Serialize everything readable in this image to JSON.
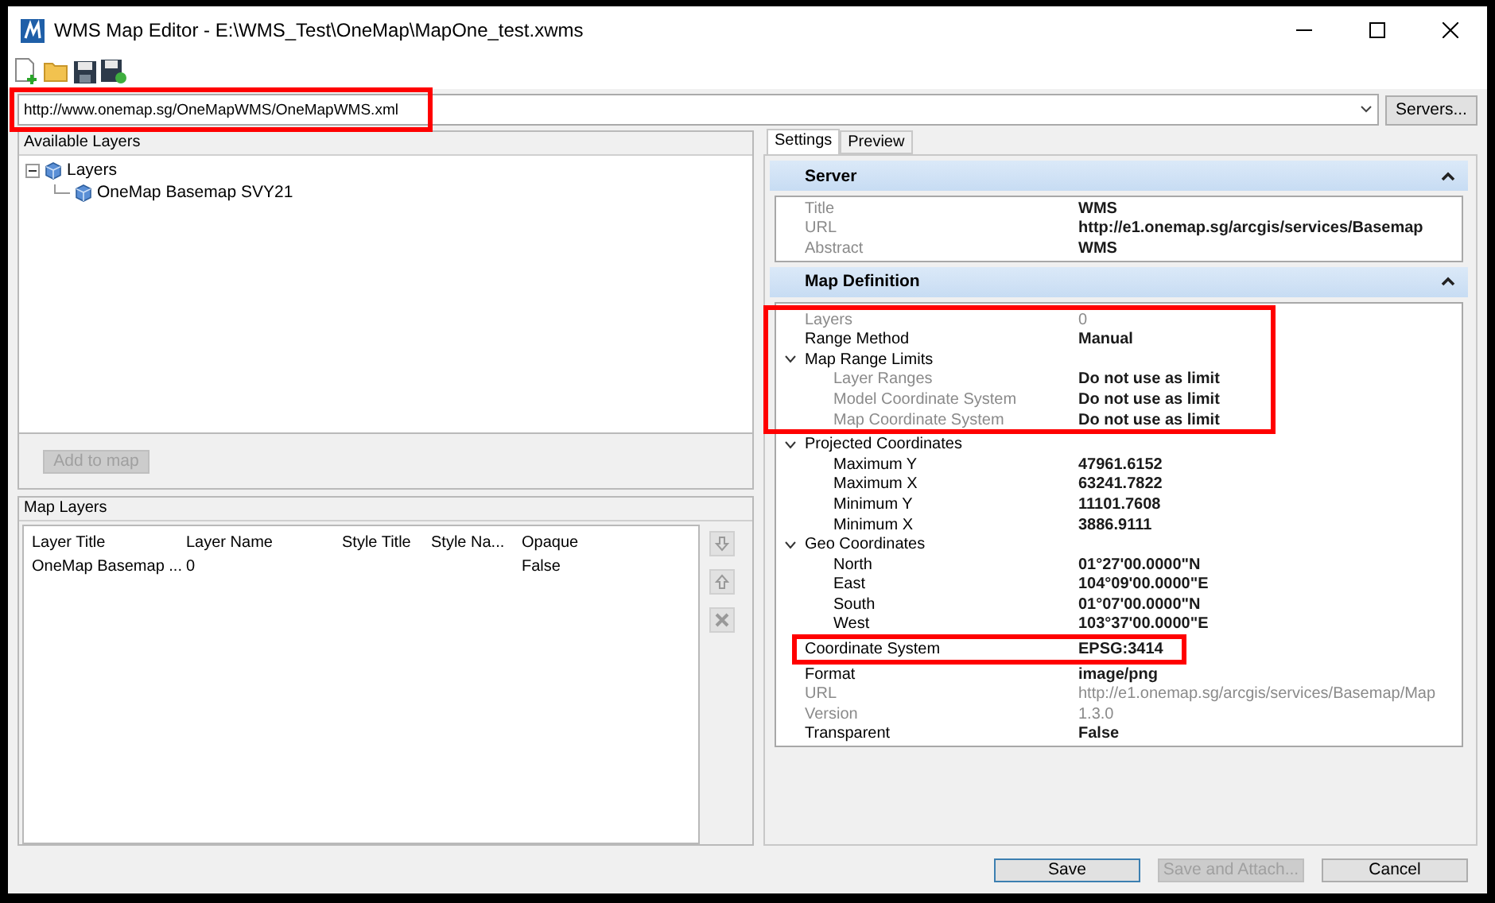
{
  "window": {
    "title": "WMS Map Editor - E:\\WMS_Test\\OneMap\\MapOne_test.xwms"
  },
  "url_bar": {
    "value": "http://www.onemap.sg/OneMapWMS/OneMapWMS.xml",
    "button": "Servers...",
    "highlighted": true
  },
  "available_layers": {
    "title": "Available Layers",
    "tree": [
      {
        "label": "Layers",
        "expanded": true,
        "children": [
          {
            "label": "OneMap Basemap SVY21"
          }
        ]
      }
    ],
    "add_button": {
      "label": "Add to map",
      "disabled": true
    }
  },
  "map_layers": {
    "title": "Map Layers",
    "columns": [
      "Layer Title",
      "Layer Name",
      "Style Title",
      "Style Na...",
      "Opaque"
    ],
    "rows": [
      [
        "OneMap Basemap ...",
        "0",
        "",
        "",
        "False"
      ]
    ]
  },
  "tabs": [
    {
      "label": "Settings",
      "selected": true
    },
    {
      "label": "Preview",
      "selected": false
    }
  ],
  "sections": [
    {
      "title": "Server",
      "expanded": true,
      "rows": [
        {
          "label": "Title",
          "value": "WMS",
          "disabled": true,
          "value_muted": false
        },
        {
          "label": "URL",
          "value": "http://e1.onemap.sg/arcgis/services/Basemap",
          "disabled": true,
          "value_muted": false
        },
        {
          "label": "Abstract",
          "value": "WMS",
          "disabled": true,
          "value_muted": false
        }
      ]
    },
    {
      "title": "Map Definition",
      "expanded": true,
      "rows": [
        {
          "label": "Layers",
          "value": "0",
          "disabled": true,
          "value_muted": true,
          "highlighted": true
        },
        {
          "label": "Range Method",
          "value": "Manual",
          "disabled": false,
          "value_muted": false,
          "highlighted": true
        },
        {
          "label": "Map Range Limits",
          "expanded": true,
          "disabled": false,
          "highlighted": true,
          "children": [
            {
              "label": "Layer Ranges",
              "value": "Do not use as limit",
              "disabled": true,
              "value_muted": false
            },
            {
              "label": "Model Coordinate System",
              "value": "Do not use as limit",
              "disabled": true,
              "value_muted": false
            },
            {
              "label": "Map Coordinate System",
              "value": "Do not use as limit",
              "disabled": true,
              "value_muted": false
            }
          ]
        },
        {
          "label": "Projected Coordinates",
          "expanded": true,
          "disabled": false,
          "children": [
            {
              "label": "Maximum Y",
              "value": "47961.6152",
              "disabled": false,
              "value_muted": false
            },
            {
              "label": "Maximum X",
              "value": "63241.7822",
              "disabled": false,
              "value_muted": false
            },
            {
              "label": "Minimum Y",
              "value": "11101.7608",
              "disabled": false,
              "value_muted": false
            },
            {
              "label": "Minimum X",
              "value": "3886.9111",
              "disabled": false,
              "value_muted": false
            }
          ]
        },
        {
          "label": "Geo Coordinates",
          "expanded": true,
          "disabled": false,
          "children": [
            {
              "label": "North",
              "value": "01°27'00.0000\"N",
              "disabled": false,
              "value_muted": false
            },
            {
              "label": "East",
              "value": "104°09'00.0000\"E",
              "disabled": false,
              "value_muted": false
            },
            {
              "label": "South",
              "value": "01°07'00.0000\"N",
              "disabled": false,
              "value_muted": false
            },
            {
              "label": "West",
              "value": "103°37'00.0000\"E",
              "disabled": false,
              "value_muted": false
            }
          ]
        },
        {
          "label": "Coordinate System",
          "value": "EPSG:3414",
          "disabled": false,
          "value_muted": false,
          "highlighted": true
        },
        {
          "label": "Format",
          "value": "image/png",
          "disabled": false,
          "value_muted": false
        },
        {
          "label": "URL",
          "value": "http://e1.onemap.sg/arcgis/services/Basemap/Map",
          "disabled": true,
          "value_muted": true
        },
        {
          "label": "Version",
          "value": "1.3.0",
          "disabled": true,
          "value_muted": true
        },
        {
          "label": "Transparent",
          "value": "False",
          "disabled": false,
          "value_muted": false
        }
      ]
    }
  ],
  "buttons": [
    {
      "label": "Save",
      "kind": "default",
      "disabled": false
    },
    {
      "label": "Save and Attach...",
      "kind": "normal",
      "disabled": true
    },
    {
      "label": "Cancel",
      "kind": "normal",
      "disabled": false
    }
  ]
}
